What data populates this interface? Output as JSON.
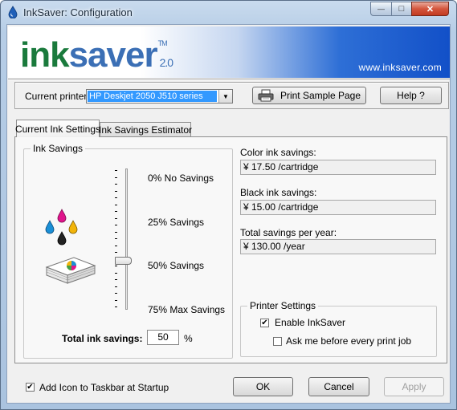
{
  "window": {
    "title": "InkSaver: Configuration",
    "min_glyph": "—",
    "max_glyph": "□",
    "close_glyph": "✕"
  },
  "banner": {
    "logo_ink": "ink",
    "logo_saver": "saver",
    "logo_tm": "TM",
    "logo_version": "2.0",
    "website": "www.inksaver.com"
  },
  "printer": {
    "label": "Current printer:",
    "selected": "HP Deskjet 2050 J510 series",
    "print_sample_label": "Print Sample Page",
    "help_label": "Help ?"
  },
  "tabs": [
    {
      "label": "Current Ink Settings",
      "active": true
    },
    {
      "label": "Ink Savings Estimator",
      "active": false
    }
  ],
  "ink_savings": {
    "group_label": "Ink Savings",
    "slider_levels": [
      "0% No Savings",
      "25% Savings",
      "50% Savings",
      "75% Max Savings"
    ],
    "slider_value_percent": 50,
    "total_label": "Total ink savings:",
    "total_value": "50",
    "total_unit": "%"
  },
  "estimates": {
    "color_label": "Color ink savings:",
    "color_value": "¥ 17.50 /cartridge",
    "black_label": "Black ink savings:",
    "black_value": "¥ 15.00 /cartridge",
    "year_label": "Total savings per year:",
    "year_value": "¥ 130.00 /year"
  },
  "printer_settings": {
    "group_label": "Printer Settings",
    "enable_label": "Enable InkSaver",
    "enable_checked": true,
    "ask_label": "Ask me before every print job",
    "ask_checked": false
  },
  "footer": {
    "taskbar_label": "Add Icon to Taskbar at Startup",
    "taskbar_checked": true,
    "ok_label": "OK",
    "cancel_label": "Cancel",
    "apply_label": "Apply",
    "apply_enabled": false
  },
  "check_glyph": "✔",
  "colors": {
    "selection": "#3399ff",
    "logo_green": "#1a7a3c",
    "logo_blue": "#3b6fb5",
    "banner_blue": "#1250c8",
    "close_red": "#c23b22"
  },
  "icons": [
    "inksaver-app-icon",
    "printer-icon",
    "ink-drops-icon",
    "paper-stack-icon",
    "check-icon",
    "dropdown-arrow-icon"
  ]
}
